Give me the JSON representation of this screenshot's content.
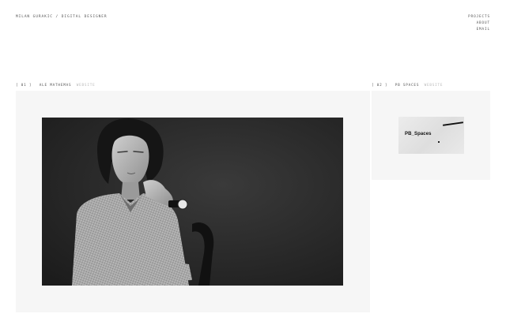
{
  "header": {
    "brand": "MILAN GURAKIC / DIGITAL DESIGNER",
    "nav": [
      "PROJECTS",
      "ABOUT",
      "EMAIL"
    ]
  },
  "projects": [
    {
      "number": "[ 01 ]",
      "title": "ALE MATHEMAS",
      "tag": "WEBSITE"
    },
    {
      "number": "[ 02 ]",
      "title": "PB SPACES",
      "tag": "WEBSITE",
      "thumb_text": "PB_Spaces"
    }
  ]
}
